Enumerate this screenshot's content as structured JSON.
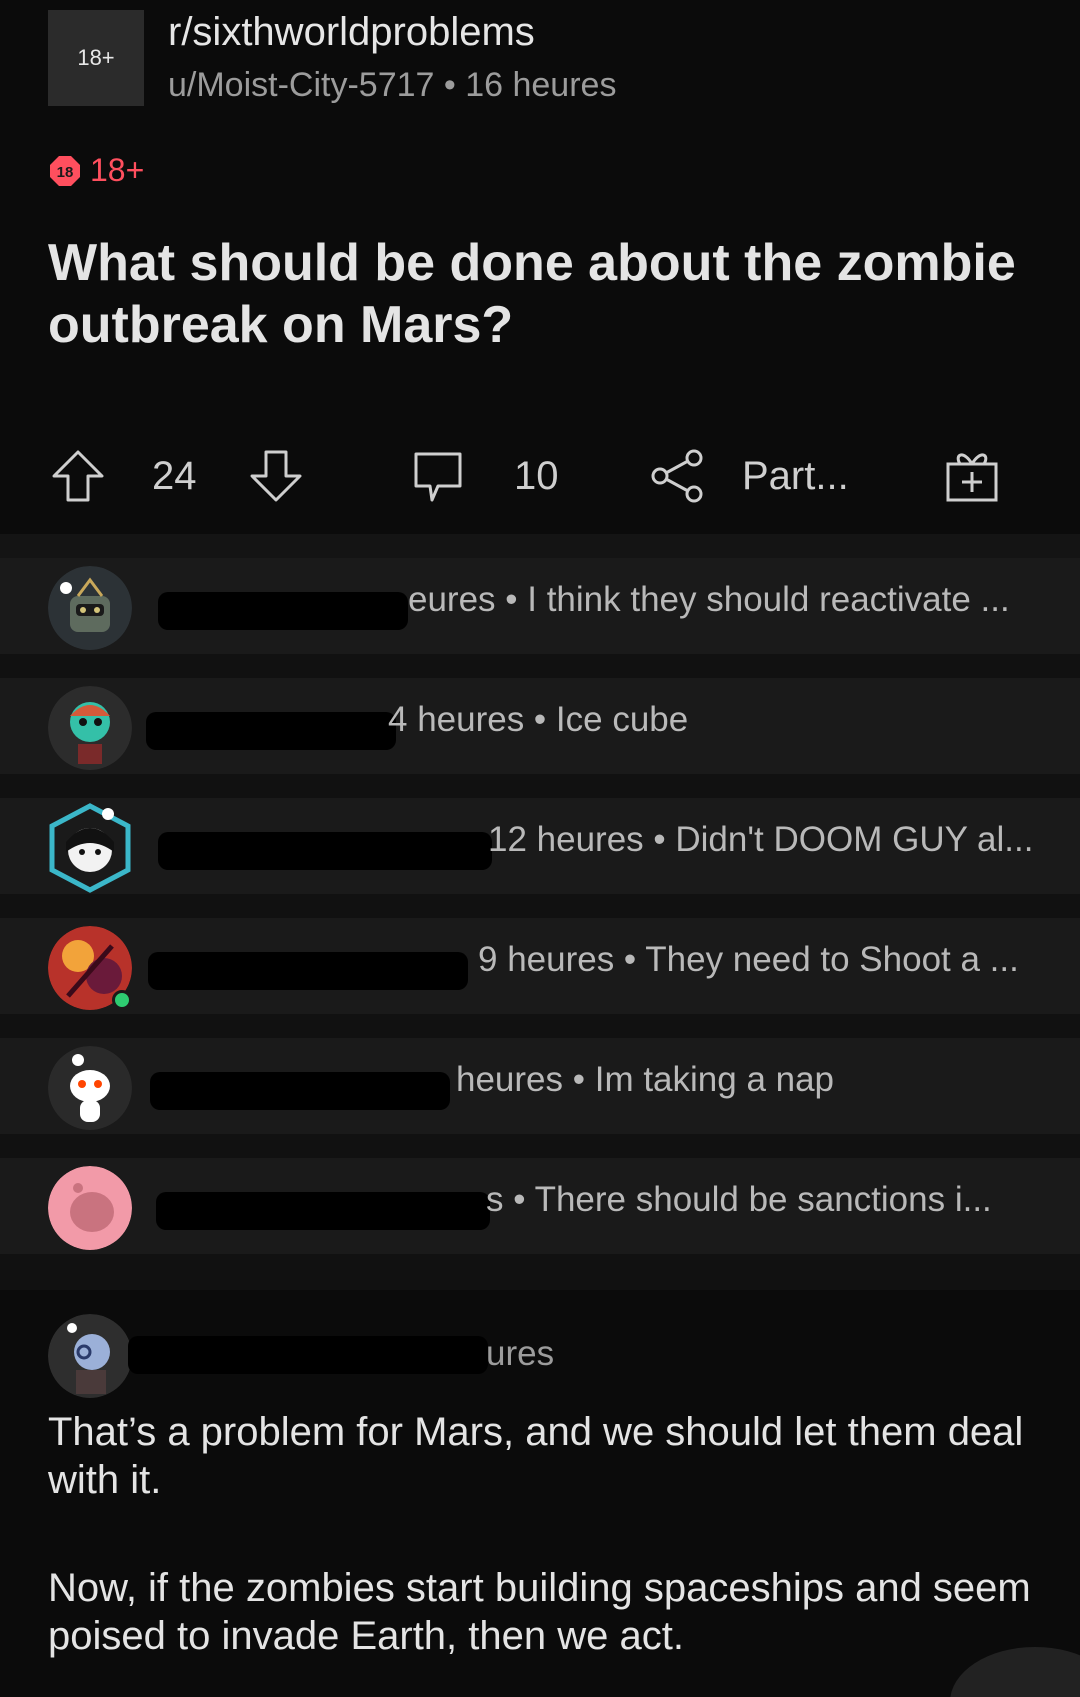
{
  "post": {
    "subreddit_avatar_label": "18+",
    "subreddit": "r/sixthworldproblems",
    "meta": "u/Moist-City-5717 • 16 heures",
    "nsfw_badge_number": "18",
    "nsfw_label": "18+",
    "title": "What should be done about the zombie outbreak on Mars?"
  },
  "actions": {
    "upvote_icon": "arrow-up-icon",
    "score": "24",
    "downvote_icon": "arrow-down-icon",
    "comment_icon": "comment-bubble-icon",
    "comment_count": "10",
    "share_icon": "share-icon",
    "share_label": "Part...",
    "award_icon": "gift-icon"
  },
  "comments": [
    {
      "visible_text": "eures • I think they should reactivate ...",
      "avatar": "robot-avatar"
    },
    {
      "visible_text": "4 heures • Ice cube",
      "avatar": "zombie-avatar"
    },
    {
      "visible_text": "12 heures • Didn't  DOOM GUY  al...",
      "avatar": "hex-avatar"
    },
    {
      "visible_text": "9 heures • They need to Shoot a ...",
      "avatar": "fire-avatar",
      "online": true
    },
    {
      "visible_text": "heures • Im taking a nap",
      "avatar": "snoo-avatar"
    },
    {
      "visible_text": "s • There should be sanctions i...",
      "avatar": "pink-snoo-avatar"
    }
  ],
  "expanded_comment": {
    "meta": "ures",
    "body_paragraph_1": "That’s a problem for Mars, and we should let them deal with it.",
    "body_paragraph_2": "Now, if the zombies start building spaceships and seem poised to invade Earth, then we act."
  },
  "colors": {
    "background": "#0b0b0b",
    "card": "#1a1a1a",
    "nsfw_red": "#ff4f5e",
    "online_green": "#2ecc71"
  }
}
